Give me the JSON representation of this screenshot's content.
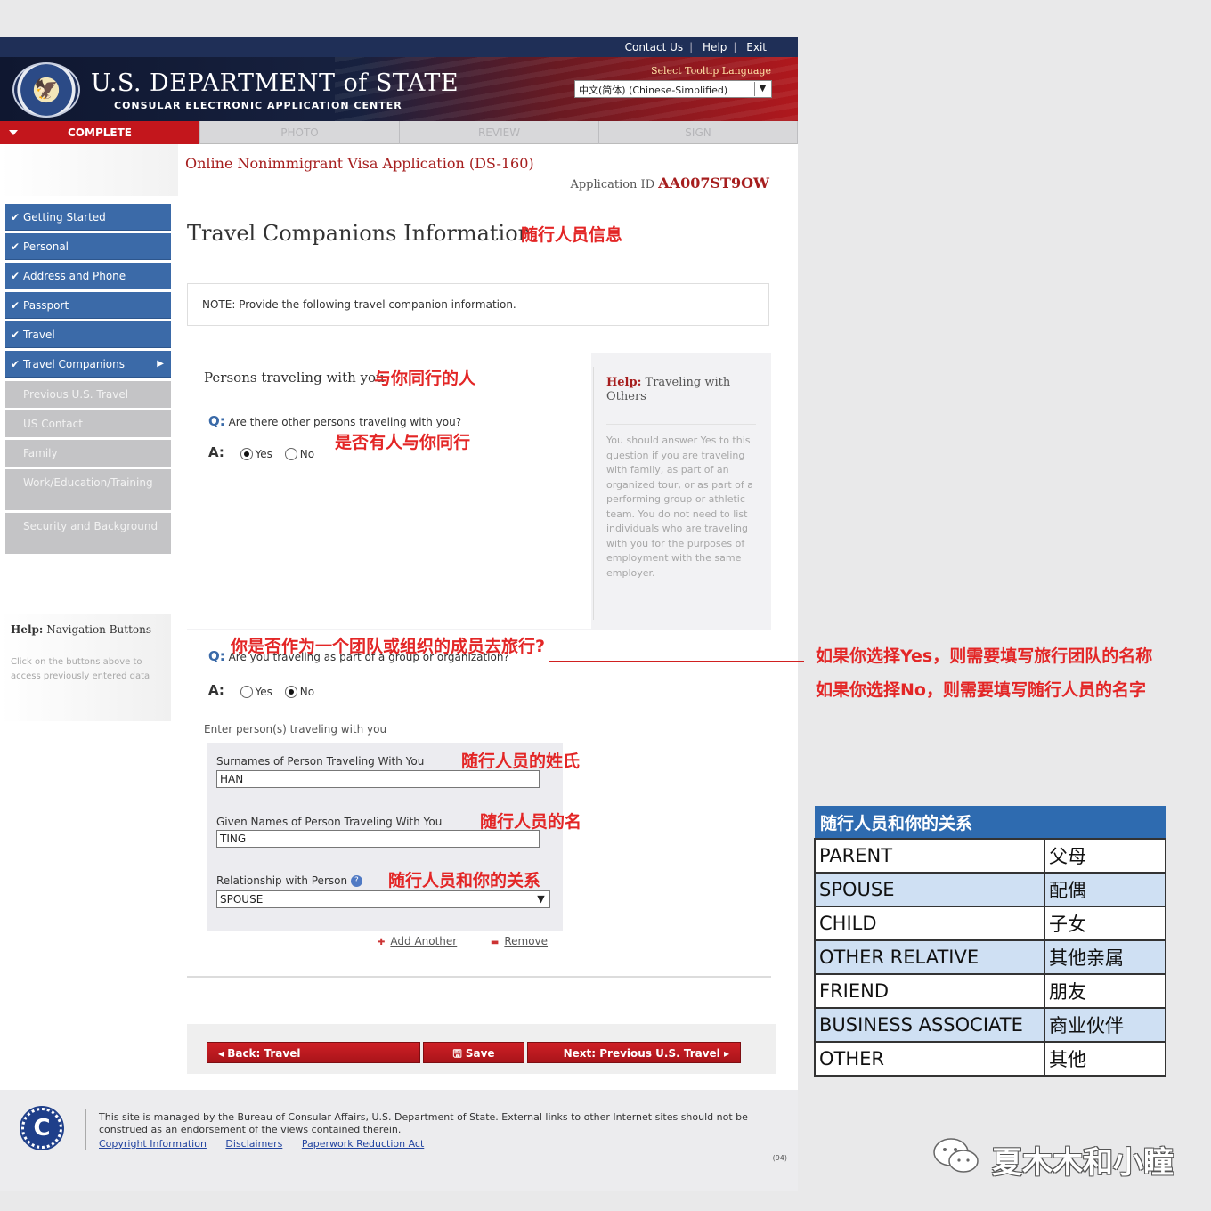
{
  "top_links": [
    "Contact Us",
    "Help",
    "Exit"
  ],
  "header": {
    "title": "U.S. DEPARTMENT of STATE",
    "subtitle": "CONSULAR ELECTRONIC APPLICATION CENTER",
    "tooltip_label": "Select Tooltip Language",
    "language_value": "中文(简体)  (Chinese-Simplified)"
  },
  "tabs": {
    "complete": "COMPLETE",
    "photo": "PHOTO",
    "review": "REVIEW",
    "sign": "SIGN"
  },
  "sidebar": {
    "done_items": [
      "Getting Started",
      "Personal",
      "Address and Phone",
      "Passport",
      "Travel",
      "Travel Companions"
    ],
    "pending_items": [
      "Previous U.S. Travel",
      "US Contact",
      "Family",
      "Work/Education/Training",
      "Security and Background"
    ],
    "help_title_bold": "Help:",
    "help_title": "Navigation Buttons",
    "help_text": "Click on the buttons above to access previously entered data"
  },
  "form_title": "Online Nonimmigrant Visa Application (DS-160)",
  "app_id_label": "Application ID",
  "app_id": "AA007ST9OW",
  "page_title": "Travel Companions Information",
  "note": "NOTE: Provide the following travel companion information.",
  "section_heading": "Persons traveling with you",
  "q1": {
    "q_label": "Q:",
    "a_label": "A:",
    "text": "Are there other persons traveling with you?",
    "yes": "Yes",
    "no": "No",
    "selected": "yes"
  },
  "help_panel": {
    "title_bold": "Help:",
    "title": "Traveling with Others",
    "text": "You should answer Yes to this question if you are traveling with family, as part of an organized tour, or as part of a performing group or athletic team. You do not need to list individuals who are traveling with you for the purposes of employment with the same employer."
  },
  "q2": {
    "q_label": "Q:",
    "a_label": "A:",
    "text": "Are you traveling as part of a group or organization?",
    "yes": "Yes",
    "no": "No",
    "selected": "no"
  },
  "enter_persons": "Enter person(s) traveling with you",
  "fields": {
    "surname_label": "Surnames of Person Traveling With You",
    "surname_value": "HAN",
    "given_label": "Given Names of Person Traveling With You",
    "given_value": "TING",
    "relationship_label": "Relationship with Person",
    "relationship_value": "SPOUSE",
    "help_dot": "?"
  },
  "add_another": "Add Another",
  "remove": "Remove",
  "buttons": {
    "back": "Back: Travel",
    "save": "Save",
    "next": "Next: Previous U.S. Travel"
  },
  "footer": {
    "text": "This site is managed by the Bureau of Consular Affairs, U.S. Department of State. External links to other Internet sites should not be construed as an endorsement of the views contained therein.",
    "links": [
      "Copyright Information",
      "Disclaimers",
      "Paperwork Reduction Act"
    ],
    "code": "(94)",
    "seal_letter": "C"
  },
  "annotations": {
    "title_cn": "随行人员信息",
    "persons_cn": "与你同行的人",
    "q1_cn": "是否有人与你同行",
    "q2_cn": "你是否作为一个团队或组织的成员去旅行?",
    "surname_cn": "随行人员的姓氏",
    "given_cn": "随行人员的名",
    "relationship_cn": "随行人员和你的关系",
    "side_yes": "如果你选择Yes，则需要填写旅行团队的名称",
    "side_no": "如果你选择No，则需要填写随行人员的名字"
  },
  "relationship_table": {
    "header": "随行人员和你的关系",
    "rows": [
      [
        "PARENT",
        "父母"
      ],
      [
        "SPOUSE",
        "配偶"
      ],
      [
        "CHILD",
        "子女"
      ],
      [
        "OTHER RELATIVE",
        "其他亲属"
      ],
      [
        "FRIEND",
        "朋友"
      ],
      [
        "BUSINESS ASSOCIATE",
        "商业伙伴"
      ],
      [
        "OTHER",
        "其他"
      ]
    ]
  },
  "watermark": "夏木木和小瞳",
  "colors": {
    "accent_red": "#c3161c",
    "nav_blue": "#3b6aa8",
    "annotation_red": "#e32626",
    "table_header": "#2e6bb0"
  }
}
